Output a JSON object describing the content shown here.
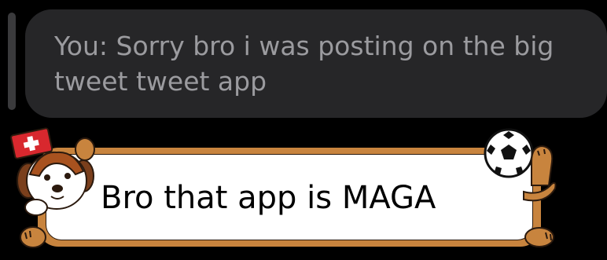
{
  "reply": {
    "prefix": "You:",
    "text": "Sorry bro i was posting on the big tweet tweet app"
  },
  "message": {
    "text": "Bro that app is MAGA"
  },
  "colors": {
    "background": "#000000",
    "reply_bubble": "#262628",
    "reply_text": "#9b9b9f",
    "bubble_frame": "#c8843e",
    "bubble_fill": "#ffffff"
  },
  "icons": {
    "dog_sticker": "swiss-dog-icon",
    "ball_sticker": "soccer-ball-icon"
  }
}
